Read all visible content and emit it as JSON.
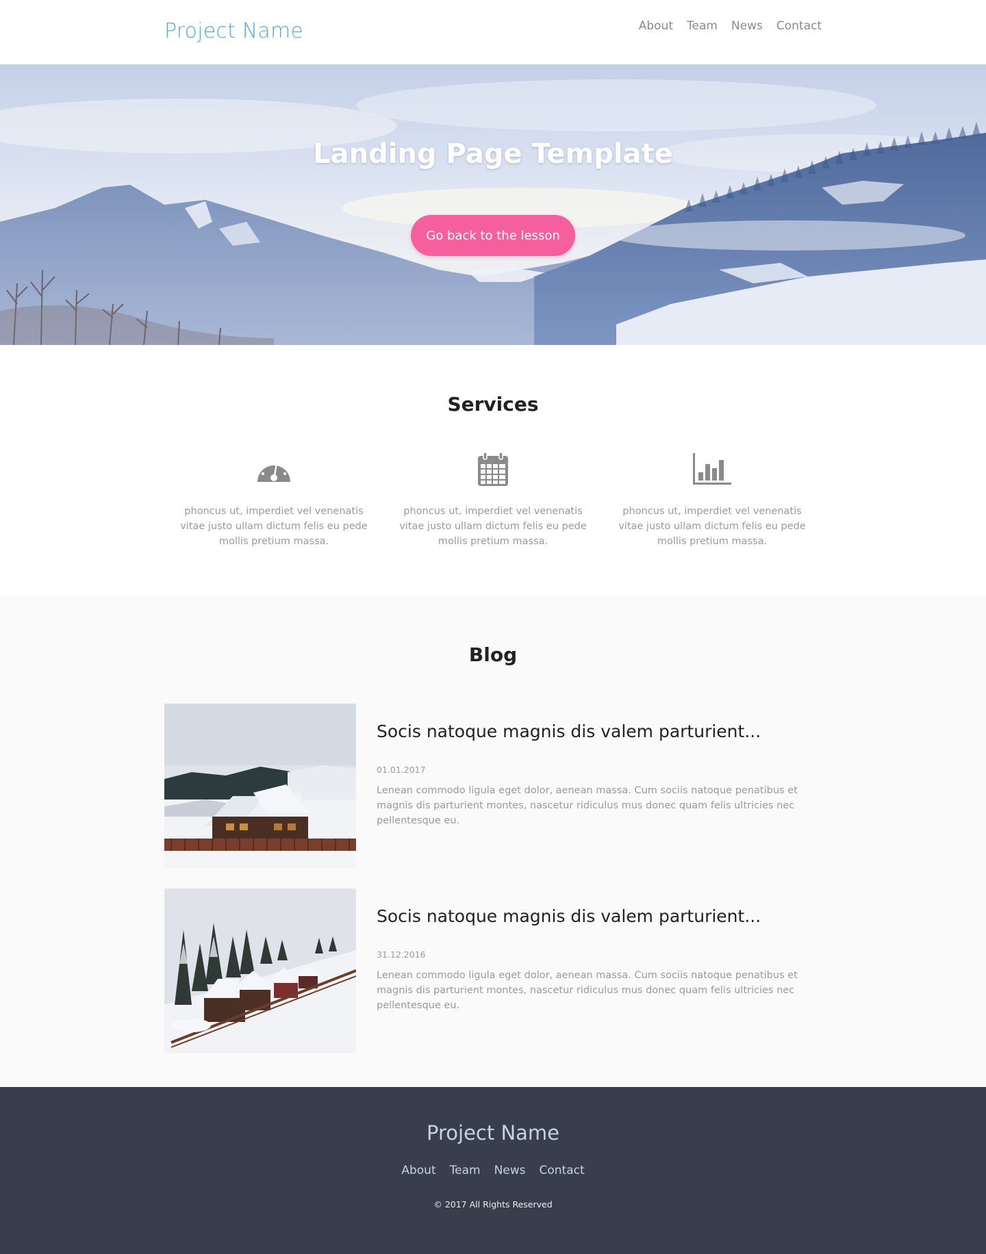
{
  "header": {
    "logo": "Project Name",
    "nav": [
      "About",
      "Team",
      "News",
      "Contact"
    ]
  },
  "hero": {
    "title": "Landing Page Template",
    "button_label": "Go back to the lesson"
  },
  "services": {
    "title": "Services",
    "items": [
      {
        "icon": "dashboard-icon",
        "text": "phoncus ut, imperdiet vel venenatis vitae justo ullam dictum felis eu pede mollis pretium massa."
      },
      {
        "icon": "calendar-icon",
        "text": "phoncus ut, imperdiet vel venenatis vitae justo ullam dictum felis eu pede mollis pretium massa."
      },
      {
        "icon": "bar-chart-icon",
        "text": "phoncus ut, imperdiet vel venenatis vitae justo ullam dictum felis eu pede mollis pretium massa."
      }
    ]
  },
  "blog": {
    "title": "Blog",
    "posts": [
      {
        "title": "Socis natoque magnis dis valem parturient...",
        "date": "01.01.2017",
        "excerpt": "Lenean commodo ligula eget dolor, aenean massa. Cum sociis natoque penatibus et magnis dis parturient montes, nascetur ridiculus mus donec quam felis ultricies nec pellentesque eu."
      },
      {
        "title": "Socis natoque magnis dis valem parturient...",
        "date": "31.12.2016",
        "excerpt": "Lenean commodo ligula eget dolor, aenean massa. Cum sociis natoque penatibus et magnis dis parturient montes, nascetur ridiculus mus donec quam felis ultricies nec pellentesque eu."
      }
    ]
  },
  "footer": {
    "logo": "Project Name",
    "nav": [
      "About",
      "Team",
      "News",
      "Contact"
    ],
    "copyright": "© 2017 All Rights Reserved"
  },
  "colors": {
    "brand": "#5aa7d8",
    "accent": "#f55f9e",
    "footer_bg": "#383e4b",
    "blog_bg": "#fafafa"
  }
}
